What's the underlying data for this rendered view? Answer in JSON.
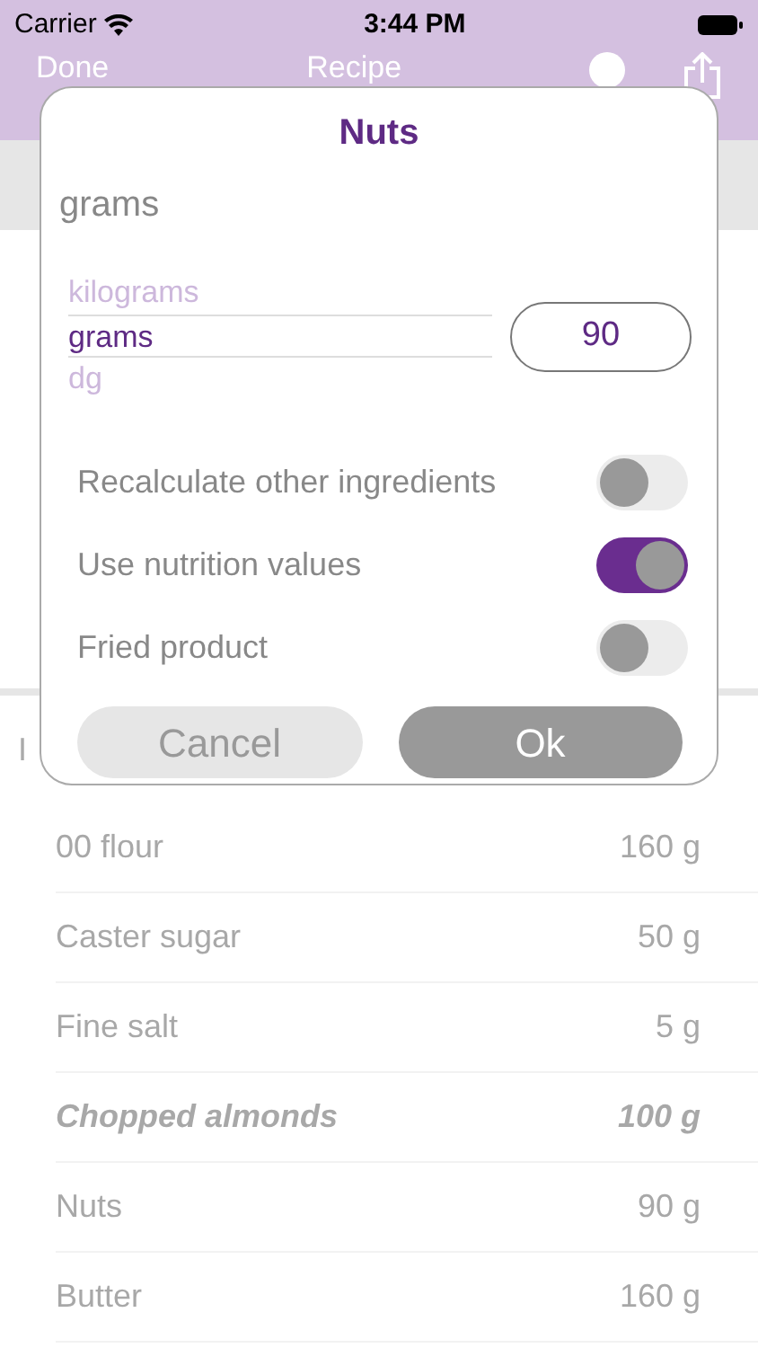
{
  "status_bar": {
    "carrier": "Carrier",
    "time": "3:44 PM"
  },
  "nav_bar": {
    "left": "Done",
    "title": "Recipe"
  },
  "section_header": "I",
  "ingredients": [
    {
      "name": "00 flour",
      "amount": "160 g",
      "kind": "plain"
    },
    {
      "name": "Caster sugar",
      "amount": "50 g",
      "kind": "plain"
    },
    {
      "name": "Fine salt",
      "amount": "5 g",
      "kind": "plain"
    },
    {
      "name": "Chopped almonds",
      "amount": "100 g",
      "kind": "emphasis"
    },
    {
      "name": "Nuts",
      "amount": "90 g",
      "kind": "plain"
    },
    {
      "name": "Butter",
      "amount": "160 g",
      "kind": "plain"
    }
  ],
  "dialog": {
    "title": "Nuts",
    "unit": "grams",
    "unit_picker": [
      {
        "label": "kilograms",
        "selected": false
      },
      {
        "label": "grams",
        "selected": true
      },
      {
        "label": "dg",
        "selected": false
      }
    ],
    "amount": "90",
    "toggles": [
      {
        "label": "Recalculate other ingredients",
        "on": false
      },
      {
        "label": "Use nutrition values",
        "on": true
      },
      {
        "label": "Fried product",
        "on": false
      }
    ],
    "buttons": [
      {
        "label": "Cancel",
        "kind": "secondary"
      },
      {
        "label": "Ok",
        "kind": "primary"
      }
    ]
  }
}
